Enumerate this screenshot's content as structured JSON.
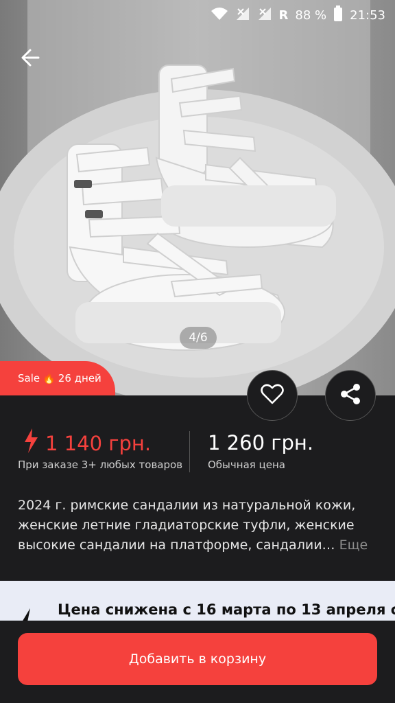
{
  "status_bar": {
    "battery_percent": "88 %",
    "time": "21:53",
    "network_letter": "R"
  },
  "gallery": {
    "counter": "4/6"
  },
  "sale_badge": {
    "label": "Sale",
    "emoji": "🔥",
    "days": "26 дней"
  },
  "price": {
    "sale_price": "1 140 грн.",
    "sale_note": "При заказе 3+ любых товаров",
    "regular_price": "1 260 грн.",
    "regular_note": "Обычная цена"
  },
  "description": {
    "text": "2024 г. римские сандалии из натуральной кожи, женские летние гладиаторские туфли, женские высокие сандалии на платформе, сандалии…",
    "more_label": "Еще"
  },
  "promo": {
    "text": "Цена снижена с 16 марта по 13 апреля с"
  },
  "cart_button": {
    "label": "Добавить в корзину"
  },
  "colors": {
    "accent": "#f5413d",
    "background": "#1c1c1e",
    "promo_bg": "#e9ecf6"
  },
  "icons": [
    "back-arrow-icon",
    "wifi-icon",
    "signal-icon",
    "battery-icon",
    "heart-icon",
    "share-icon",
    "lightning-icon"
  ]
}
